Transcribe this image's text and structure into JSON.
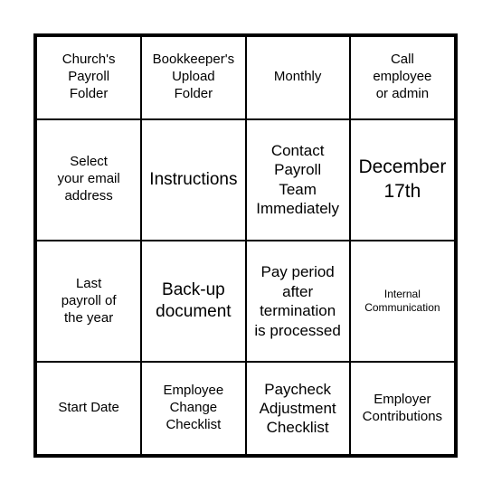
{
  "card": {
    "type": "bingo-card",
    "rows": 4,
    "columns": 4,
    "border_color": "#000000",
    "background_color": "#ffffff",
    "text_color": "#000000",
    "cells": [
      [
        {
          "text": "Church's\nPayroll\nFolder",
          "size": "fs-sm"
        },
        {
          "text": "Bookkeeper's\nUpload\nFolder",
          "size": "fs-sm"
        },
        {
          "text": "Monthly",
          "size": "fs-sm"
        },
        {
          "text": "Call\nemployee\nor admin",
          "size": "fs-sm"
        }
      ],
      [
        {
          "text": "Select\nyour email\naddress",
          "size": "fs-sm"
        },
        {
          "text": "Instructions",
          "size": "fs-lg"
        },
        {
          "text": "Contact\nPayroll\nTeam\nImmediately",
          "size": "fs-md"
        },
        {
          "text": "December\n17th",
          "size": "fs-xl"
        }
      ],
      [
        {
          "text": "Last\npayroll of\nthe year",
          "size": "fs-sm"
        },
        {
          "text": "Back-up\ndocument",
          "size": "fs-lg"
        },
        {
          "text": "Pay period\nafter\ntermination\nis processed",
          "size": "fs-md"
        },
        {
          "text": "Internal\nCommunication",
          "size": "fs-xs"
        }
      ],
      [
        {
          "text": "Start Date",
          "size": "fs-sm"
        },
        {
          "text": "Employee\nChange\nChecklist",
          "size": "fs-sm"
        },
        {
          "text": "Paycheck\nAdjustment\nChecklist",
          "size": "fs-md"
        },
        {
          "text": "Employer\nContributions",
          "size": "fs-sm"
        }
      ]
    ]
  }
}
